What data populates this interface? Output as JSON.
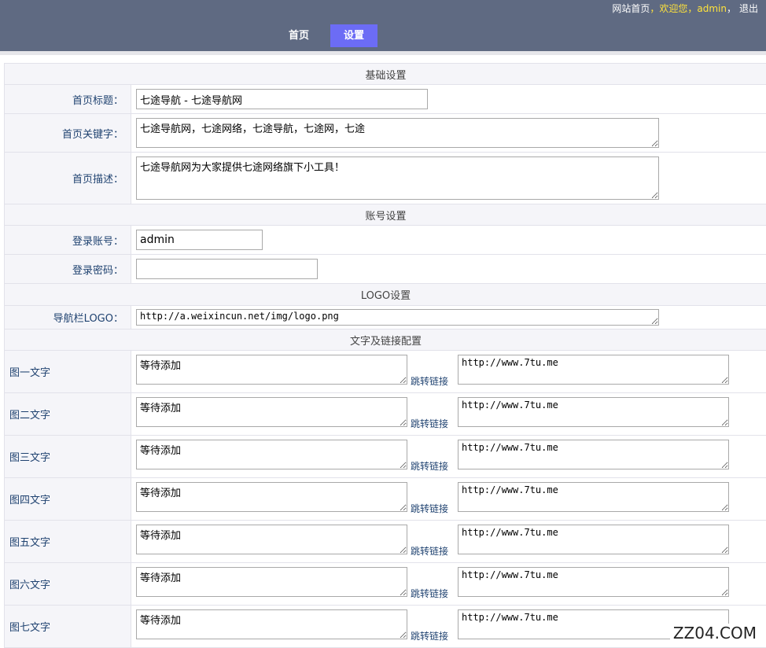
{
  "header": {
    "links": {
      "site_home": "网站首页",
      "sep1": "，",
      "welcome": "欢迎您，",
      "user": "admin",
      "sep2": "，",
      "logout": "退出"
    },
    "nav": [
      {
        "label": "首页"
      },
      {
        "label": "设置"
      }
    ],
    "colors": {
      "bar": "#5f6a82",
      "active_tab": "#6c6cf5",
      "highlight": "#ffe33b"
    }
  },
  "sections": {
    "basic": "基础设置",
    "account": "账号设置",
    "logo": "LOGO设置",
    "links": "文字及链接配置"
  },
  "basic": {
    "title_label": "首页标题：",
    "title_value": "七途导航 - 七途导航网",
    "keywords_label": "首页关键字：",
    "keywords_value": "七途导航网，七途网络，七途导航，七途网，七途",
    "desc_label": "首页描述：",
    "desc_value": "七途导航网为大家提供七途网络旗下小工具！"
  },
  "account": {
    "user_label": "登录账号：",
    "user_value": "admin",
    "pass_label": "登录密码：",
    "pass_value": ""
  },
  "logo": {
    "label": "导航栏LOGO：",
    "value": "http://a.weixincun.net/img/logo.png"
  },
  "link_rows": [
    {
      "label": "图一文字",
      "text": "等待添加",
      "jump_label": "跳转链接",
      "url": "http://www.7tu.me"
    },
    {
      "label": "图二文字",
      "text": "等待添加",
      "jump_label": "跳转链接",
      "url": "http://www.7tu.me"
    },
    {
      "label": "图三文字",
      "text": "等待添加",
      "jump_label": "跳转链接",
      "url": "http://www.7tu.me"
    },
    {
      "label": "图四文字",
      "text": "等待添加",
      "jump_label": "跳转链接",
      "url": "http://www.7tu.me"
    },
    {
      "label": "图五文字",
      "text": "等待添加",
      "jump_label": "跳转链接",
      "url": "http://www.7tu.me"
    },
    {
      "label": "图六文字",
      "text": "等待添加",
      "jump_label": "跳转链接",
      "url": "http://www.7tu.me"
    },
    {
      "label": "图七文字",
      "text": "等待添加",
      "jump_label": "跳转链接",
      "url": "http://www.7tu.me"
    }
  ],
  "watermark": "ZZ04.COM"
}
